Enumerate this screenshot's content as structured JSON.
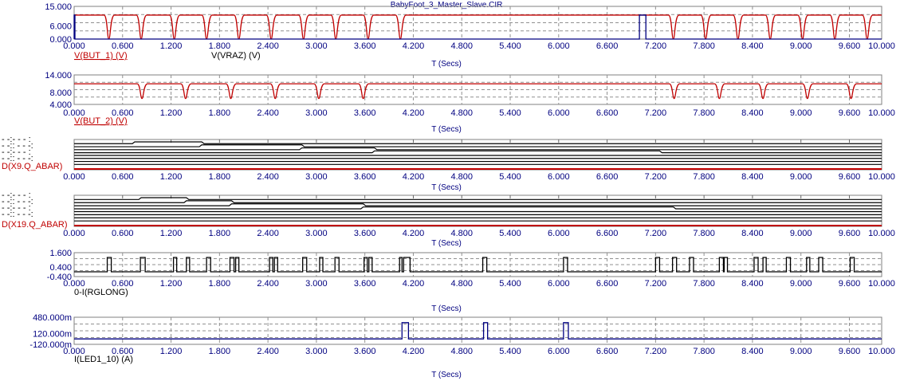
{
  "title": "BabyFoot_3_Master_Slave.CIR",
  "colors": {
    "axis": "#000080",
    "red": "#c00000",
    "blue": "#000080",
    "black": "#000000",
    "grid": "#808080"
  },
  "chart_data": [
    {
      "type": "line",
      "title": "",
      "xlabel": "T (Secs)",
      "xlim": [
        0,
        10
      ],
      "ylim": [
        0,
        15
      ],
      "yticks": [
        "15.000",
        "6.000",
        "0.000"
      ],
      "ytick_values": [
        15,
        6,
        0
      ],
      "legend": [
        "V(BUT_1) (V)",
        "V(VRAZ) (V)"
      ],
      "series": [
        {
          "name": "V(BUT_1)",
          "color": "#c00000",
          "high": 11,
          "low": 0,
          "dips": [
            0.43,
            0.83,
            1.24,
            1.64,
            2.04,
            2.44,
            2.84,
            3.24,
            3.64,
            4.04,
            7.42,
            7.82,
            8.22,
            8.62,
            9.02,
            9.42,
            9.82
          ]
        },
        {
          "name": "V(VRAZ)",
          "color": "#000080",
          "pulses": [
            [
              0,
              0.0
            ],
            [
              7.0,
              7.08
            ]
          ],
          "high": 11
        }
      ]
    },
    {
      "type": "line",
      "xlabel": "T (Secs)",
      "xlim": [
        0,
        10
      ],
      "ylim": [
        4,
        14
      ],
      "yticks": [
        "14.000",
        "8.000",
        "4.000"
      ],
      "ytick_values": [
        14,
        8,
        4
      ],
      "legend": [
        "V(BUT_2) (V)"
      ],
      "series": [
        {
          "name": "V(BUT_2)",
          "color": "#c00000",
          "high": 11,
          "low": 6,
          "dips": [
            0.84,
            1.38,
            1.94,
            2.49,
            3.03,
            3.58,
            7.43,
            7.99,
            8.53,
            9.08,
            9.62
          ]
        }
      ]
    },
    {
      "type": "digital",
      "xlabel": "T (Secs)",
      "xlim": [
        0,
        10
      ],
      "legend": [
        "D(X9.Q_ABAR)"
      ],
      "lines": 8,
      "steps": [
        0.75,
        1.58,
        2.82,
        3.72,
        7.25,
        8.05,
        8.9,
        9.6
      ]
    },
    {
      "type": "digital",
      "xlabel": "T (Secs)",
      "xlim": [
        0,
        10
      ],
      "legend": [
        "D(X19.Q_ABAR)"
      ],
      "lines": 8,
      "steps": [
        0.83,
        1.39,
        1.95,
        3.58,
        7.42,
        7.99,
        8.53,
        9.62
      ]
    },
    {
      "type": "line",
      "xlabel": "T (Secs)",
      "xlim": [
        0,
        10
      ],
      "ylim": [
        -0.4,
        1.6
      ],
      "yticks": [
        "1.600",
        "0.400",
        "-0.400"
      ],
      "ytick_values": [
        1.6,
        0.4,
        -0.4
      ],
      "legend": [
        "0-I(RGLONG)"
      ],
      "series": [
        {
          "name": "0-I(RGLONG)",
          "color": "#000000",
          "low": 0,
          "high": 1.2,
          "pulses": [
            [
              0.41,
              0.46
            ],
            [
              0.82,
              0.88
            ],
            [
              1.23,
              1.27
            ],
            [
              1.39,
              1.43
            ],
            [
              1.64,
              1.69
            ],
            [
              1.93,
              1.98
            ],
            [
              2.0,
              2.04
            ],
            [
              2.42,
              2.46
            ],
            [
              2.48,
              2.52
            ],
            [
              2.83,
              2.88
            ],
            [
              3.04,
              3.08
            ],
            [
              3.23,
              3.28
            ],
            [
              3.59,
              3.63
            ],
            [
              3.65,
              3.69
            ],
            [
              4.03,
              4.06
            ],
            [
              4.08,
              4.16
            ],
            [
              5.06,
              5.11
            ],
            [
              6.06,
              6.11
            ],
            [
              7.2,
              7.25
            ],
            [
              7.41,
              7.46
            ],
            [
              7.62,
              7.67
            ],
            [
              7.99,
              8.04
            ],
            [
              8.05,
              8.09
            ],
            [
              8.42,
              8.47
            ],
            [
              8.53,
              8.57
            ],
            [
              8.82,
              8.87
            ],
            [
              9.07,
              9.11
            ],
            [
              9.22,
              9.27
            ],
            [
              9.61,
              9.66
            ]
          ]
        }
      ]
    },
    {
      "type": "line",
      "xlabel": "T (Secs)",
      "xlim": [
        0,
        10
      ],
      "ylim": [
        -0.12,
        0.48
      ],
      "yticks": [
        "480.000m",
        "120.000m",
        "-120.000m"
      ],
      "ytick_values": [
        0.48,
        0.12,
        -0.12
      ],
      "legend": [
        "I(LED1_10) (A)"
      ],
      "series": [
        {
          "name": "I(LED1_10)",
          "color": "#000080",
          "low": 0,
          "high": 0.36,
          "pulses": [
            [
              4.06,
              4.14
            ],
            [
              5.07,
              5.12
            ],
            [
              6.06,
              6.12
            ]
          ]
        }
      ]
    }
  ],
  "xticks": [
    "0.000",
    "0.600",
    "1.200",
    "1.800",
    "2.400",
    "3.000",
    "3.600",
    "4.200",
    "4.800",
    "5.400",
    "6.000",
    "6.600",
    "7.200",
    "7.800",
    "8.400",
    "9.000",
    "9.600",
    "10.000"
  ],
  "digital_label_rows": [
    "- -:- - - :",
    "- -:: - - -:",
    "- -:- - - :",
    "- -:: - - -:"
  ]
}
